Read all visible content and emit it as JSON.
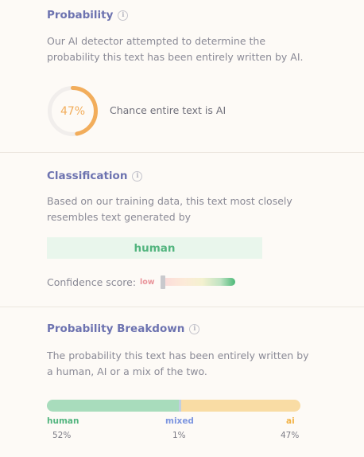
{
  "probability": {
    "title": "Probability",
    "description": "Our AI detector attempted to determine the probability this text has been entirely written by AI.",
    "percent_label": "47%",
    "percent_value": 47,
    "caption": "Chance entire text is AI",
    "ring_color": "#f2ad5b",
    "ring_track_color": "#f1eeec"
  },
  "classification": {
    "title": "Classification",
    "description": "Based on our training data, this text most closely resembles text generated by",
    "result": "human",
    "confidence_label": "Confidence score:",
    "confidence_level": "low"
  },
  "breakdown": {
    "title": "Probability Breakdown",
    "description": "The probability this text has been entirely written by a human, AI or a mix of the two.",
    "segments": [
      {
        "key": "human",
        "label": "human",
        "value_label": "52%",
        "percent": 52,
        "color": "#53b57f"
      },
      {
        "key": "mixed",
        "label": "mixed",
        "value_label": "1%",
        "percent": 1,
        "color": "#7d96e0"
      },
      {
        "key": "ai",
        "label": "ai",
        "value_label": "47%",
        "percent": 47,
        "color": "#f2b347"
      }
    ]
  }
}
